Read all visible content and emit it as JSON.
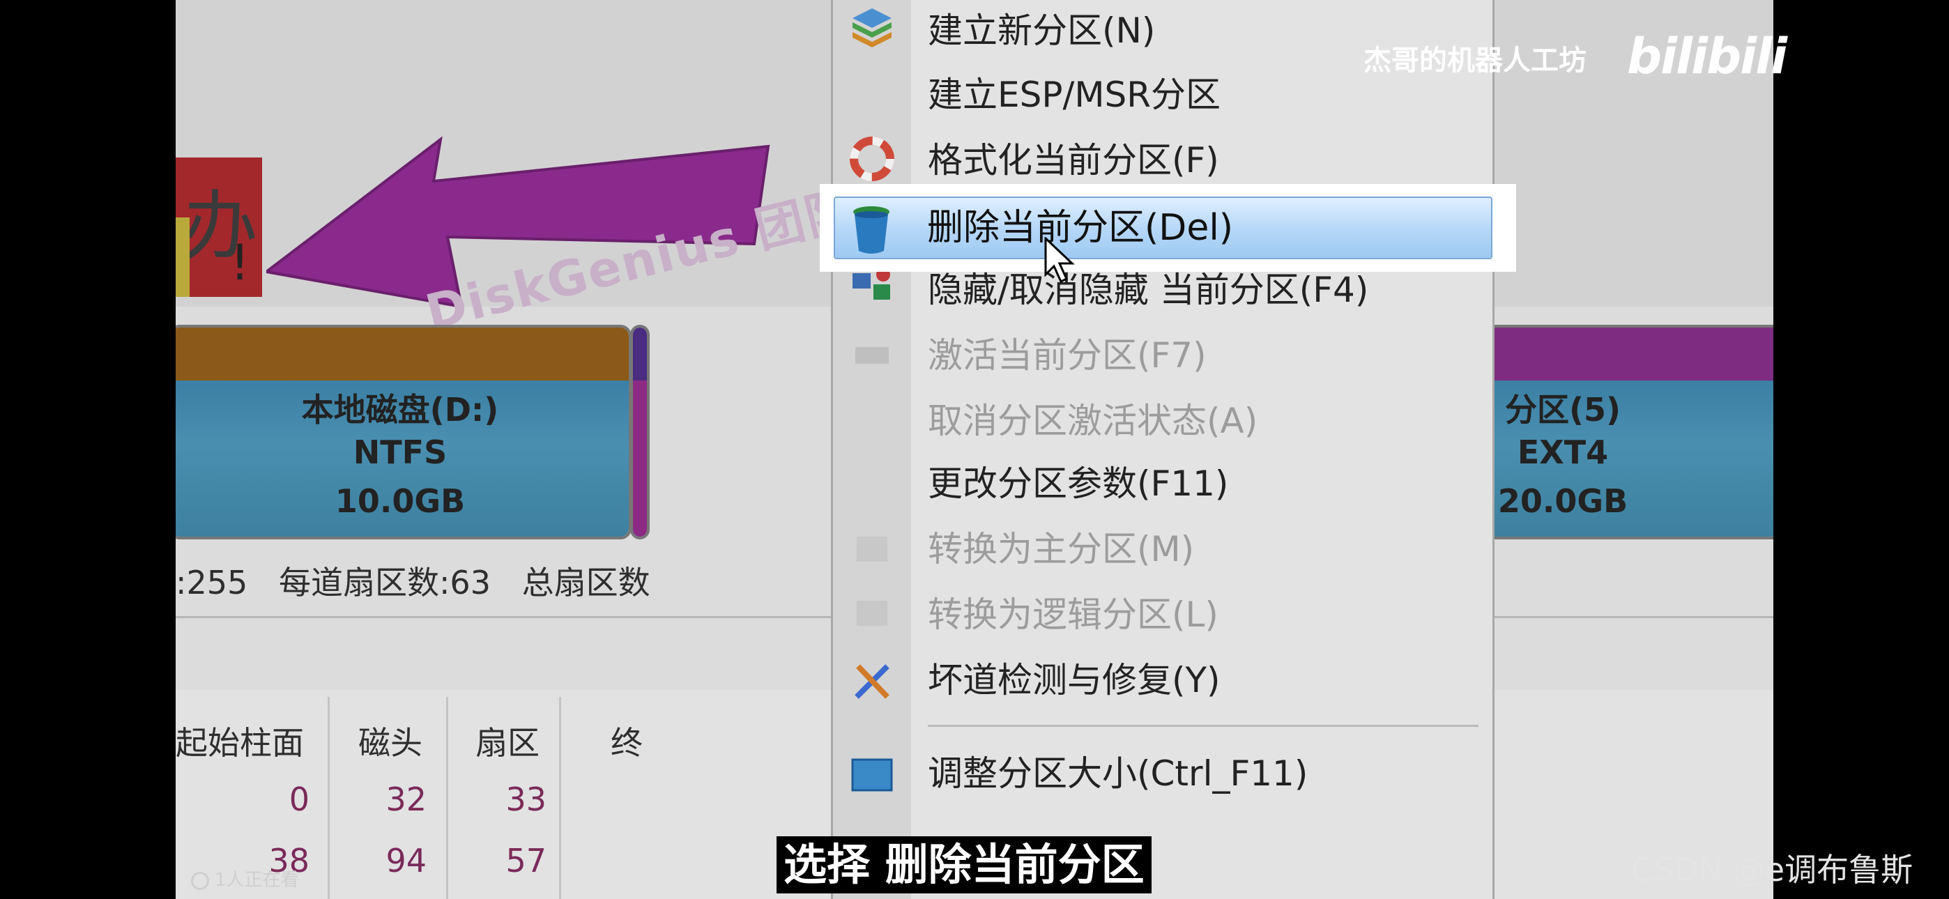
{
  "overlay": {
    "channel_name": "杰哥的机器人工坊",
    "platform_logo": "bilibili",
    "subtitle": "选择 删除当前分区",
    "watermark": "CSDN @e调布鲁斯",
    "viewers": "1人正在看"
  },
  "banner": {
    "char": "办",
    "excl": "!",
    "arrow_text": "DiskGenius 团队"
  },
  "partitions": [
    {
      "name": "本地磁盘(D:)",
      "fs": "NTFS",
      "size": "10.0GB"
    },
    {
      "name": "分区(5)",
      "fs": "EXT4",
      "size": "20.0GB"
    }
  ],
  "geometry": {
    "heads": ":255",
    "sectors_per_track": "每道扇区数:63",
    "total_sectors": "总扇区数"
  },
  "table": {
    "headers": [
      "起始柱面",
      "磁头",
      "扇区",
      "终"
    ],
    "rows": [
      [
        "0",
        "32",
        "33"
      ],
      [
        "38",
        "94",
        "57"
      ]
    ]
  },
  "context_menu": {
    "items": [
      {
        "label": "建立新分区(N)",
        "enabled": true,
        "icon": "new-partition-icon"
      },
      {
        "label": "建立ESP/MSR分区",
        "enabled": true,
        "icon": ""
      },
      {
        "label": "格式化当前分区(F)",
        "enabled": true,
        "icon": "format-lifebuoy-icon"
      },
      {
        "label": "删除当前分区(Del)",
        "enabled": true,
        "icon": "trash-can-icon",
        "highlighted": true
      },
      {
        "label": "隐藏/取消隐藏 当前分区(F4)",
        "enabled": true,
        "icon": "hide-partition-icon"
      },
      {
        "label": "激活当前分区(F7)",
        "enabled": false,
        "icon": "activate-icon"
      },
      {
        "label": "取消分区激活状态(A)",
        "enabled": false,
        "icon": ""
      },
      {
        "label": "更改分区参数(F11)",
        "enabled": true,
        "icon": ""
      },
      {
        "label": "转换为主分区(M)",
        "enabled": false,
        "icon": "convert-primary-icon"
      },
      {
        "label": "转换为逻辑分区(L)",
        "enabled": false,
        "icon": "convert-logical-icon"
      },
      {
        "label": "坏道检测与修复(Y)",
        "enabled": true,
        "icon": "bad-sector-tools-icon"
      },
      {
        "label": "调整分区大小(Ctrl_F11)",
        "enabled": true,
        "icon": "resize-icon"
      }
    ]
  },
  "colors": {
    "highlight": "#b4d6f7",
    "partition_body": "#3b7fa4",
    "ntfs_stripe": "#8b5a18",
    "ext4_stripe": "#7e2c82"
  }
}
